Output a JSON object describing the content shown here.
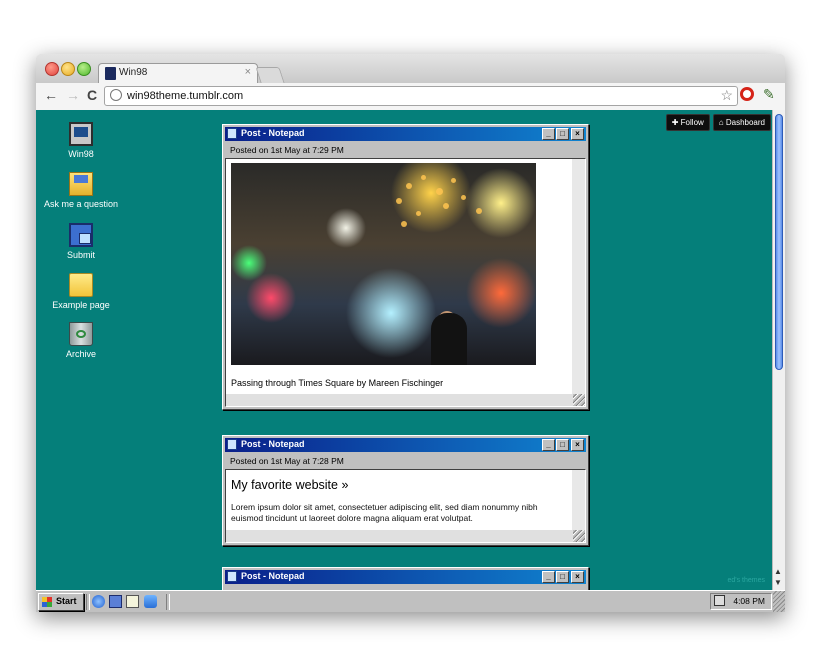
{
  "browser": {
    "tab_title": "Win98",
    "tab_close": "×",
    "url": "win98theme.tumblr.com",
    "back": "←",
    "forward": "→",
    "reload": "C",
    "star": "☆",
    "wrench": "✎"
  },
  "desktop_icons": [
    {
      "label": "Win98",
      "icon": "computer-icon"
    },
    {
      "label": "Ask me a question",
      "icon": "mail-folder-icon"
    },
    {
      "label": "Submit",
      "icon": "network-icon"
    },
    {
      "label": "Example page",
      "icon": "folder-icon"
    },
    {
      "label": "Archive",
      "icon": "recycle-bin-icon"
    }
  ],
  "tumblr_controls": {
    "follow": "Follow",
    "dashboard": "Dashboard"
  },
  "posts": [
    {
      "window_title": "Post - Notepad",
      "posted": "Posted on 1st May at 7:29 PM",
      "caption": "Passing through Times Square by Mareen Fischinger"
    },
    {
      "window_title": "Post - Notepad",
      "posted": "Posted on 1st May at 7:28 PM",
      "heading": "My favorite website »",
      "body": "Lorem ipsum dolor sit amet, consectetuer adipiscing elit, sed diam nonummy nibh euismod tincidunt ut laoreet dolore magna aliquam erat volutpat."
    },
    {
      "window_title": "Post - Notepad"
    }
  ],
  "window_buttons": {
    "minimize": "_",
    "maximize": "□",
    "close": "×"
  },
  "credit": "ed's themes",
  "taskbar": {
    "start": "Start",
    "clock": "4:08 PM"
  },
  "scroll": {
    "up": "▲",
    "down": "▼"
  }
}
